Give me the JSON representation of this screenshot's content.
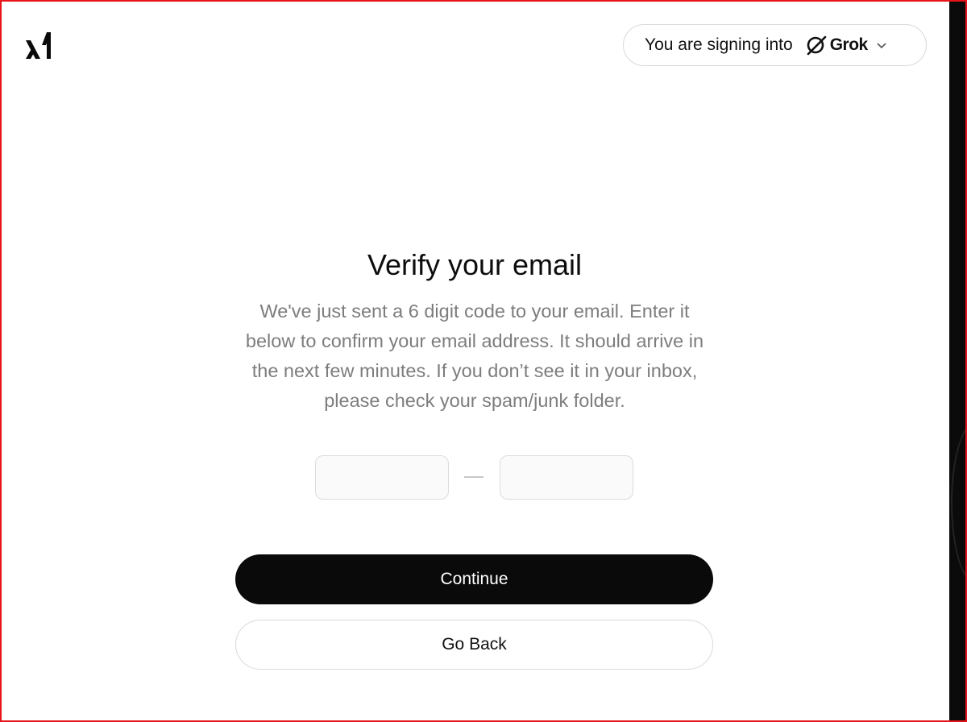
{
  "header": {
    "logo": "xai-logo-icon",
    "signin_prefix": "You are signing into",
    "product_icon": "grok-icon",
    "product_name": "Grok",
    "dropdown_icon": "chevron-down-icon"
  },
  "main": {
    "title": "Verify your email",
    "description": "We've just sent a 6 digit code to your email. Enter it below to confirm your email address. It should arrive in the next few minutes. If you don’t see it in your inbox, please check your spam/junk folder.",
    "code_inputs": [
      "",
      "",
      "",
      "",
      "",
      ""
    ],
    "continue_label": "Continue",
    "back_label": "Go Back"
  },
  "colors": {
    "primary_button": "#0a0a0a",
    "text_muted": "#7d7d7d",
    "border": "#d9d9d9"
  }
}
